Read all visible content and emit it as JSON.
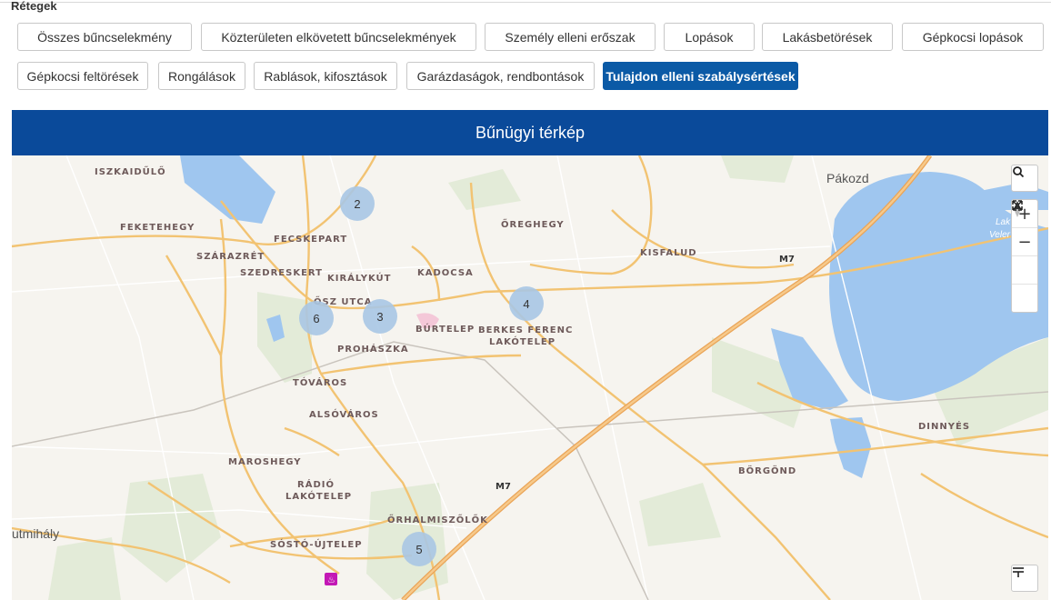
{
  "layers": {
    "title": "Rétegek",
    "buttons": [
      {
        "label": "Összes bűncselekmény",
        "active": false
      },
      {
        "label": "Közterületen elkövetett bűncselekmények",
        "active": false
      },
      {
        "label": "Személy elleni erőszak",
        "active": false
      },
      {
        "label": "Lopások",
        "active": false
      },
      {
        "label": "Lakásbetörések",
        "active": false
      },
      {
        "label": "Gépkocsi lopások",
        "active": false
      },
      {
        "label": "Gépkocsi feltörések",
        "active": false
      },
      {
        "label": "Rongálások",
        "active": false
      },
      {
        "label": "Rablások, kifosztások",
        "active": false
      },
      {
        "label": "Garázdaságok, rendbontások",
        "active": false
      },
      {
        "label": "Tulajdon elleni szabálysértések",
        "active": true
      }
    ]
  },
  "map": {
    "title": "Bűnügyi térkép",
    "place_labels": [
      "ISZKAIDŰLŐ",
      "FEKETEHEGY",
      "FECSKEPART",
      "SZÁRAZRÉT",
      "SZEDRESKERT",
      "KIRÁLYKÚT",
      "KADOCSA",
      "ŐREGHEGY",
      "KISFALUD",
      "ŐSZ UTCA",
      "BÚRTELEP",
      "BERKES FERENC",
      "LAKÓTELEP",
      "PROHÁSZKA",
      "TÓVÁROS",
      "ALSÓVÁROS",
      "MAROSHEGY",
      "RÁDIÓ",
      "LAKÓTELEP",
      "ŐRHALMISZŐLŐK",
      "SÓSTÓ-ÚJTELEP",
      "BÖRGÖND",
      "DINNYÉS"
    ],
    "town_labels": [
      "Pákozd",
      "utmihály"
    ],
    "lake_labels": [
      "Lak",
      "Veler"
    ],
    "road_labels": [
      "M7",
      "M7"
    ],
    "clusters": [
      "2",
      "6",
      "3",
      "4",
      "5"
    ],
    "controls": {
      "search_icon": "search-icon",
      "zoom_in": "+",
      "zoom_out": "−",
      "compass_icon": "compass-icon",
      "fullscreen_icon": "fullscreen-icon",
      "layers_icon": "layers-icon"
    },
    "colors": {
      "water": "#9fc6ef",
      "road_major": "#f2c372",
      "motorway": "#f0b060",
      "green": "#e3ebd8",
      "cluster": "#a9c7e4",
      "header": "#0a4a9a",
      "active_button": "#0b5aa6"
    }
  }
}
